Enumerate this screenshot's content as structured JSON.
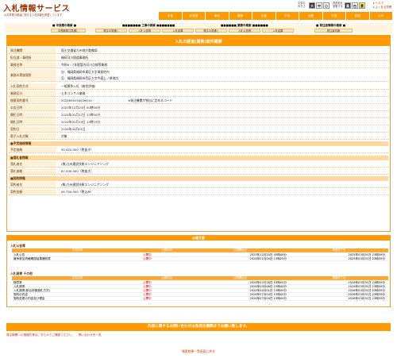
{
  "header": {
    "title": "入札情報サービス",
    "subtitle": "公共事業の調達に関する入札情報を掲載しています",
    "font_label_1": "文字の",
    "font_label_2": "大きさ",
    "font_sizes": [
      "大",
      "中",
      "小"
    ],
    "color_label_1": "背景色を",
    "color_label_2": "変更する",
    "color_options": [
      "黒",
      "白",
      "黄"
    ],
    "help_label": "ヘルプ",
    "faq_label": "よくある質問"
  },
  "regions": [
    "本省",
    "北海道",
    "東北",
    "関東",
    "北陸",
    "中部",
    "近畿",
    "中国",
    "四国",
    "九州"
  ],
  "nav": {
    "groups": [
      {
        "title": "■ 中長期の検索 ■",
        "items": [
          "中長期発注見通し"
        ]
      },
      {
        "title": "■■■■■■■ 工事の検索 ■■■■■■■",
        "items": [
          "発注の見通し",
          "入札公告等",
          "入札結果"
        ]
      },
      {
        "title": "■■■■■■ 業務の検索 ■■■■■■",
        "items": [
          "発注の見通し",
          "入札公告等",
          "入札結果"
        ]
      },
      {
        "title": "■ 発注者情報の検索 ■",
        "items": [
          "発注者情報"
        ]
      }
    ]
  },
  "detail": {
    "title": "入札の経過(業務)案件概要",
    "fields": [
      {
        "label": "発注機関",
        "value": "国土交通省九州地方整備局"
      },
      {
        "label": "担当部・事務所",
        "value": "福岡河川国道事務所"
      },
      {
        "label": "業務名称",
        "value": "令和6・7年度管内河川点検等業務"
      },
      {
        "label": "業務の実施場所",
        "value": "自：福岡県福岡市東区大字津屋地内"
      },
      {
        "label": "",
        "value": "至：福岡県福岡市西区大字今宿上ノ原地内"
      },
      {
        "label": "入札契約方式",
        "value": "一般競争入札（総合評価）"
      },
      {
        "label": "業務区分",
        "value": "土木コンサル業務"
      },
      {
        "label": "随意契約番号",
        "value": "2024895250026010"
      },
      {
        "label": "公告日時",
        "value": "2023年12月20日 00時00分"
      },
      {
        "label": "開札日時",
        "value": "2024年01月17日 17時00分"
      },
      {
        "label": "開札日時",
        "value": "2024年02月19日 13時15分"
      },
      {
        "label": "契約日",
        "value": "2024年04月01日"
      },
      {
        "label": "電子入札対象",
        "value": "対象"
      }
    ],
    "yotei_head": "■予定価格情報",
    "yotei": [
      {
        "label": "予定価格",
        "value": "90,920,000（税抜き）"
      }
    ],
    "rakusatsu_head": "■落札者情報",
    "rakusatsu": [
      {
        "label": "落札者名",
        "value": "(株)九州建設技術エンジニアリング"
      },
      {
        "label": "落札価格",
        "value": "87,000,000（税抜き）"
      }
    ],
    "keiyaku_head": "■契約情報",
    "keiyaku": [
      {
        "label": "契約者名",
        "value": "(株)九州建設技術エンジニアリング"
      },
      {
        "label": "契約金額",
        "value": "95,700,000（税込み）"
      }
    ],
    "note": "※発注機関が独自に定めるコード"
  },
  "docs": {
    "title": "公開文書",
    "columns": [
      "文書名称",
      "公開状況",
      "公開開始日",
      "掲載終了日"
    ],
    "section1": "入札公告等",
    "rows1": [
      {
        "name": "入札公告",
        "status": "公開中",
        "start": "2023年12月20日 00時00分",
        "end": "2025年03月31日 23時59分"
      },
      {
        "name": "競争参加資格確認結果通知書",
        "status": "公開中",
        "start": "2024年01月04日 15時25分",
        "end": "2025年03月31日 23時59分"
      }
    ],
    "section2": "入札結果 その他",
    "rows2": [
      {
        "name": "随意書",
        "status": "公開中",
        "start": "2024年02月28日 15時00分",
        "end": "2026年03月31日 23時59分"
      },
      {
        "name": "入札調書",
        "status": "公開中",
        "start": "2024年03月06日 15時00分",
        "end": "2026年03月31日 23時59分"
      },
      {
        "name": "入札調書(総合評価落札方式)",
        "status": "公開中",
        "start": "2024年04月01日 15時00分",
        "end": "2026年03月31日 23時59分"
      },
      {
        "name": "契約の内容",
        "status": "公開中",
        "start": "2024年07月04日 15時00分",
        "end": "2026年03月31日 23時59分"
      },
      {
        "name": "契約変更の内容及び理由",
        "status": "公開中",
        "start": "2024年07月04日 15時00分",
        "end": "2026年03月31日 23時59分"
      }
    ]
  },
  "contact": {
    "bar": "内容に関するお問い合わせは各発注機関までお願い致します。",
    "link1": "発注機関への連絡先等はこちらからご確認ください。",
    "link2": "問い合わせ先一覧",
    "back": "検索結果一覧画面に戻る"
  },
  "colors": {
    "accent": "#ff9900",
    "label_bg": "#fff0d8",
    "title_brown": "#993300"
  }
}
